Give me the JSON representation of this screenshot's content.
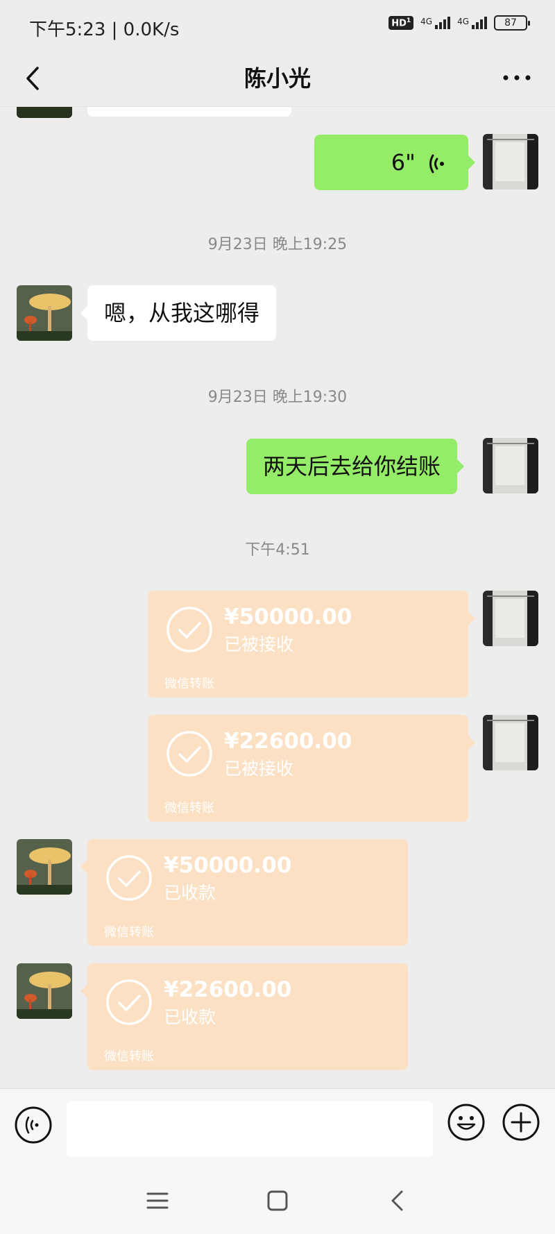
{
  "status_bar": {
    "time": "下午5:23 | 0.0K/s",
    "hd": "HD",
    "hd_sub": "1",
    "net1": "4G",
    "net2": "4G",
    "battery": "87"
  },
  "header": {
    "title": "陈小光",
    "back_icon": "chevron-left-icon",
    "more_icon": "more-dots-icon"
  },
  "messages": {
    "voice": {
      "duration": "6\"",
      "icon": "voice-wave-icon"
    },
    "ts1": "9月23日 晚上19:25",
    "msg1": "嗯，从我这哪得",
    "ts2": "9月23日 晚上19:30",
    "msg2": "两天后去给你结账",
    "ts3": "下午4:51",
    "transfers": [
      {
        "amount": "¥50000.00",
        "status": "已被接收",
        "footer": "微信转账",
        "side": "right"
      },
      {
        "amount": "¥22600.00",
        "status": "已被接收",
        "footer": "微信转账",
        "side": "right"
      },
      {
        "amount": "¥50000.00",
        "status": "已收款",
        "footer": "微信转账",
        "side": "left"
      },
      {
        "amount": "¥22600.00",
        "status": "已收款",
        "footer": "微信转账",
        "side": "left"
      }
    ]
  },
  "input_bar": {
    "value": "",
    "voice_icon": "voice-input-icon",
    "emoji_icon": "emoji-icon",
    "plus_icon": "plus-icon"
  },
  "system_nav": {
    "menu_icon": "menu-icon",
    "home_icon": "home-square-icon",
    "back_icon": "back-triangle-icon"
  },
  "colors": {
    "background": "#ededed",
    "green_bubble": "#95ec69",
    "white_bubble": "#ffffff",
    "transfer_bg": "#fbe0c4"
  }
}
